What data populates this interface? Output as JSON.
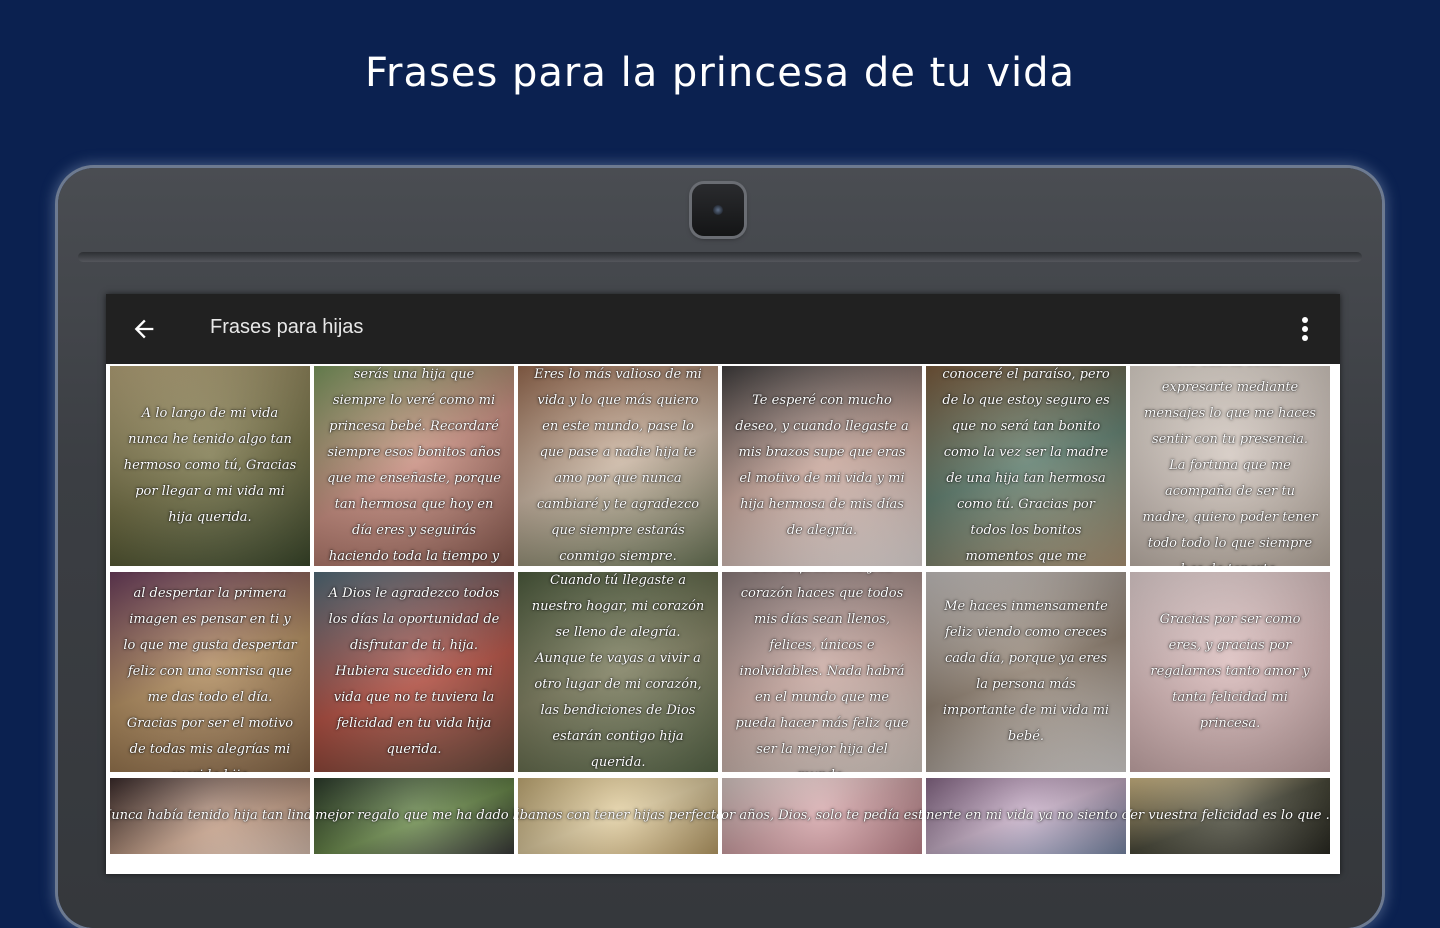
{
  "banner": {
    "title": "Frases para la princesa de tu vida"
  },
  "app_bar": {
    "back_icon": "arrow-back-icon",
    "title": "Frases para hijas",
    "menu_icon": "more-vert-icon"
  },
  "colors": {
    "background": "#0b2150",
    "app_bar": "#212121",
    "tablet_body": "#3b3e43"
  },
  "tiles": [
    {
      "text": "A lo largo de mi vida nunca he tenido algo tan hermoso como tú, Gracias por llegar a mi vida mi hija querida.",
      "bg": "linear-gradient(160deg,#b9a77a,#6d6a3e 55%,#3c4a2c)"
    },
    {
      "text": "Aquí el tiempo y siempre serás una hija que siempre lo veré como mi princesa bebé. Recordaré siempre esos bonitos años que me enseñaste, porque tan hermosa que hoy en día eres y seguirás haciendo toda la tiempo y te quiero todo mi más.",
      "bg": "linear-gradient(150deg,#7b9a5d,#c88b7d 50%,#8c5a4f)"
    },
    {
      "text": "Eres lo más valioso de mi vida y lo que más quiero en este mundo, pase lo que pase a nadie hija te amo por que nunca cambiaré y te agradezco que siempre estarás conmigo siempre.",
      "bg": "linear-gradient(160deg,#9a6a4e,#c9b4a0 50%,#6e7a5a)"
    },
    {
      "text": "Te esperé con mucho deseo, y cuando llegaste a mis brazos supe que eras el motivo de mi vida y mi hija hermosa de mis días de alegría.",
      "bg": "linear-gradient(160deg,#3d3a3a,#c9a69a 50%,#efe6e4)"
    },
    {
      "text": "No sé si algún día conoceré el paraíso, pero de lo que estoy seguro es que no será tan bonito como la vez ser la madre de una hija tan hermosa como tú. Gracias por todos los bonitos momentos que me regalas.",
      "bg": "linear-gradient(160deg,#7b5a3a,#5a7a6a 50%,#b39a7a)"
    },
    {
      "text": "No cabría como expresarte mediante mensajes lo que me haces sentir con tu presencia. La fortuna que me acompaña de ser tu madre, quiero poder tener todo todo lo que siempre has de tenerte.",
      "bg": "linear-gradient(160deg,#e5dcd2,#cfc3bb 50%,#bfb2a5)"
    },
    {
      "text": "Todos los días de mi vida al despertar la primera imagen es pensar en ti y lo que me gusta despertar feliz con una sonrisa que me das todo el día. Gracias por ser el motivo de todas mis alegrías mi querida hija.",
      "bg": "linear-gradient(160deg,#6a3a5a,#b08a5a 50%,#8a6a4a)"
    },
    {
      "text": "A Dios le agradezco todos los días la oportunidad de disfrutar de ti, hija. Hubiera sucedido en mi vida que no te tuviera la felicidad en tu vida hija querida.",
      "bg": "linear-gradient(160deg,#4f6a78,#b24a3c 55%,#6a4a3c)"
    },
    {
      "text": "Cuando tú llegaste a nuestro hogar, mi corazón se lleno de alegría. Aunque te vayas a vivir a otro lugar de mi corazón, las bendiciones de Dios estarán contigo hija querida.",
      "bg": "linear-gradient(160deg,#4a5a3a,#7a7a5a 50%,#5a6a4a)"
    },
    {
      "text": "Con tu presencia y tu corazón haces que todos mis días sean llenos, felices, únicos e inolvidables. Nada habrá en el mundo que me pueda hacer más feliz que ser la mejor hija del mundo.",
      "bg": "linear-gradient(160deg,#8a7a7a,#c9a8a0 50%,#e0d4cc)"
    },
    {
      "text": "Me haces inmensamente feliz viendo como creces cada día, porque ya eres la persona más importante de mi vida mi bebé.",
      "bg": "linear-gradient(160deg,#c9c4c2,#8a7a6a 50%,#dedad8)"
    },
    {
      "text": "Gracias por ser como eres, y gracias por regalarnos tanto amor y tanta felicidad mi princesa.",
      "bg": "linear-gradient(160deg,#e8d6d6,#d8b8b8 50%,#c8a8a8)"
    },
    {
      "text": "Nunca había tenido hija tan linda",
      "bg": "linear-gradient(160deg,#3a2a2a,#c8a28a 60%,#e2c8b8)"
    },
    {
      "text": "Sos el mejor regalo que me ha dado la vida",
      "bg": "linear-gradient(160deg,#2a3a2a,#6a8a4a 55%,#3a3a3a)"
    },
    {
      "text": "Cuando soñábamos con tener hijas perfectas nunca nos",
      "bg": "linear-gradient(160deg,#cbb27a,#e2cfa2 50%,#bfa26a)"
    },
    {
      "text": "Por años, Dios, solo te pedía esto",
      "bg": "linear-gradient(160deg,#e0d0cc,#d4a4a8 50%,#c88a92)"
    },
    {
      "text": "Después de tenerte en mi vida ya no siento otra necesidad",
      "bg": "linear-gradient(160deg,#8a6a8a,#c8b0c8 50%,#7a8aaa)"
    },
    {
      "text": "Ver vuestra felicidad es lo que ...",
      "bg": "linear-gradient(160deg,#d8c08a,#4a4a3a 50%,#2a2a22)"
    }
  ]
}
